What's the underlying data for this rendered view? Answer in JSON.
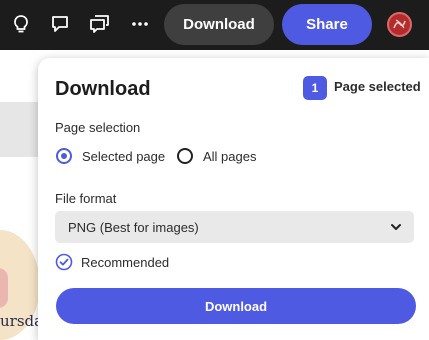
{
  "topbar": {
    "icons": [
      "lightbulb-icon",
      "comment-icon",
      "comments-icon",
      "more-icon"
    ],
    "download_label": "Download",
    "share_label": "Share"
  },
  "canvas": {
    "partial_text": "ursda"
  },
  "dialog": {
    "title": "Download",
    "selected_count": "1",
    "selected_label": "Page selected",
    "page_selection": {
      "label": "Page selection",
      "options": [
        {
          "label": "Selected page",
          "checked": true
        },
        {
          "label": "All pages",
          "checked": false
        }
      ]
    },
    "file_format": {
      "label": "File format",
      "value": "PNG (Best for images)"
    },
    "recommended_label": "Recommended",
    "download_button": "Download"
  },
  "colors": {
    "accent": "#4f5ae3",
    "topbar_bg": "#1c1c1c",
    "topbar_button_bg": "#3f3f3f"
  }
}
